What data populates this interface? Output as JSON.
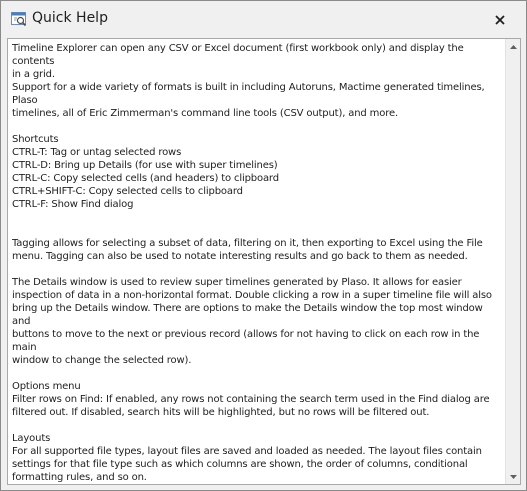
{
  "window": {
    "title": "Quick Help",
    "app_icon": "help-window-icon",
    "close_icon": "close-icon"
  },
  "help": {
    "text": "Timeline Explorer can open any CSV or Excel document (first workbook only) and display the contents\nin a grid.\nSupport for a wide variety of formats is built in including Autoruns, Mactime generated timelines, Plaso\ntimelines, all of Eric Zimmerman's command line tools (CSV output), and more.\n\nShortcuts\nCTRL-T: Tag or untag selected rows\nCTRL-D: Bring up Details (for use with super timelines)\nCTRL-C: Copy selected cells (and headers) to clipboard\nCTRL+SHIFT-C: Copy selected cells to clipboard\nCTRL-F: Show Find dialog\n\n\nTagging allows for selecting a subset of data, filtering on it, then exporting to Excel using the File\nmenu. Tagging can also be used to notate interesting results and go back to them as needed.\n\nThe Details window is used to review super timelines generated by Plaso. It allows for easier\ninspection of data in a non-horizontal format. Double clicking a row in a super timeline file will also\nbring up the Details window. There are options to make the Details window the top most window and\nbuttons to move to the next or previous record (allows for not having to click on each row in the main\nwindow to change the selected row).\n\nOptions menu\nFilter rows on Find: If enabled, any rows not containing the search term used in the Find dialog are\nfiltered out. If disabled, search hits will be highlighted, but no rows will be filtered out.\n\nLayouts\nFor all supported file types, layout files are saved and loaded as needed. The layout files contain\nsettings for that file type such as which columns are shown, the order of columns, conditional\nformatting rules, and so on."
  },
  "scrollbar": {
    "up_icon": "scroll-up-arrow-icon",
    "down_icon": "scroll-down-arrow-icon"
  }
}
